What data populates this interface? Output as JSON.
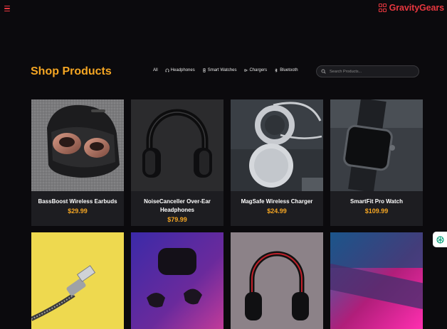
{
  "brand": {
    "name": "GravityGears",
    "icon": "grid-logo-icon",
    "color": "#e8373f"
  },
  "header": {
    "title": "Shop Products",
    "title_color": "#f5a623"
  },
  "filters": [
    {
      "label": "All",
      "icon": ""
    },
    {
      "label": "Headphones",
      "icon": "headphones-icon"
    },
    {
      "label": "Smart Watches",
      "icon": "watch-icon"
    },
    {
      "label": "Chargers",
      "icon": "charger-icon"
    },
    {
      "label": "Bluetooth",
      "icon": "bluetooth-icon"
    }
  ],
  "search": {
    "placeholder": "Search Products..."
  },
  "products": [
    {
      "name": "BassBoost Wireless Earbuds",
      "price": "$29.99"
    },
    {
      "name": "NoiseCanceller Over-Ear Headphones",
      "price": "$79.99"
    },
    {
      "name": "MagSafe Wireless Charger",
      "price": "$24.99"
    },
    {
      "name": "SmartFit Pro Watch",
      "price": "$109.99"
    }
  ],
  "accent_color": "#f5a623"
}
